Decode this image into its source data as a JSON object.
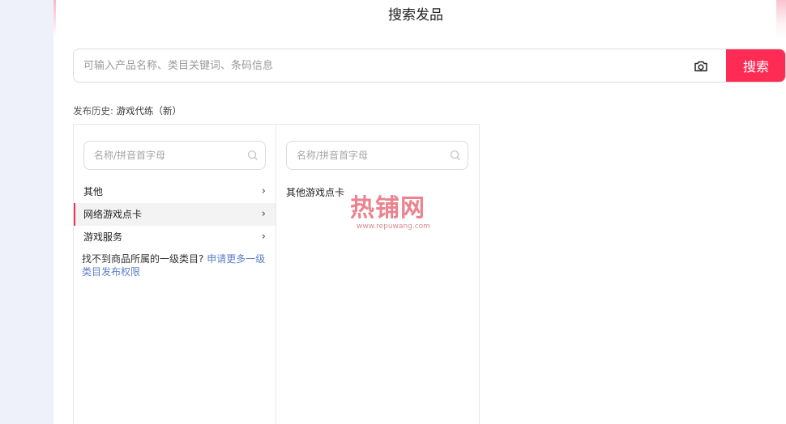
{
  "page": {
    "title": "搜索发品"
  },
  "search": {
    "placeholder": "可输入产品名称、类目关键词、条码信息",
    "button_label": "搜索"
  },
  "history": {
    "label": "发布历史:",
    "item": "游戏代练（新）"
  },
  "categories": {
    "search_placeholder": "名称/拼音首字母",
    "level1": [
      {
        "label": "其他",
        "chevron": "›"
      },
      {
        "label": "网络游戏点卡",
        "chevron": "›",
        "active": true
      },
      {
        "label": "游戏服务",
        "chevron": "›"
      }
    ],
    "help_text": "找不到商品所属的一级类目?",
    "help_link": "申请更多一级类目发布权限",
    "level2_search_placeholder": "名称/拼音首字母",
    "level2": [
      {
        "label": "其他游戏点卡"
      }
    ]
  },
  "watermark": {
    "text": "热铺网",
    "url": "www.repuwang.com"
  },
  "colors": {
    "accent": "#fe2c55",
    "link": "#5b7fc7",
    "background": "#eef0fa"
  },
  "icons": {
    "camera": "camera-icon",
    "search": "search-icon",
    "chevron": "chevron-right-icon"
  }
}
